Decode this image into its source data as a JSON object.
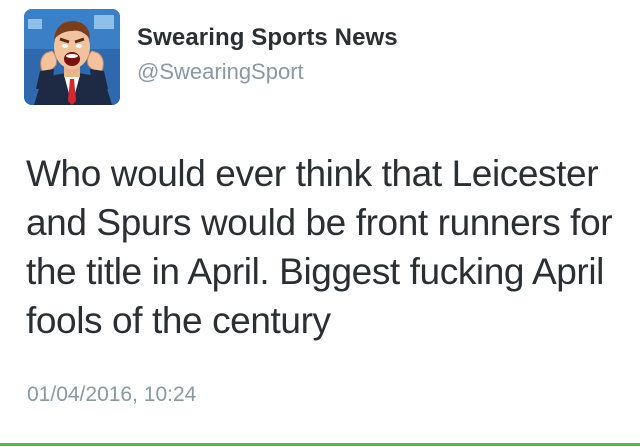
{
  "tweet": {
    "author": {
      "display_name": "Swearing Sports News",
      "handle": "@SwearingSport",
      "avatar_icon": "shouting-man-avatar"
    },
    "text": "Who would ever think that Leicester and Spurs would be front runners for the title in April. Biggest fucking April fools of the century",
    "timestamp": "01/04/2016, 10:24"
  },
  "colors": {
    "text_primary": "#292f33",
    "text_secondary": "#8899a6",
    "avatar_background": "#2f6fb4",
    "divider": "#5fb24a"
  }
}
